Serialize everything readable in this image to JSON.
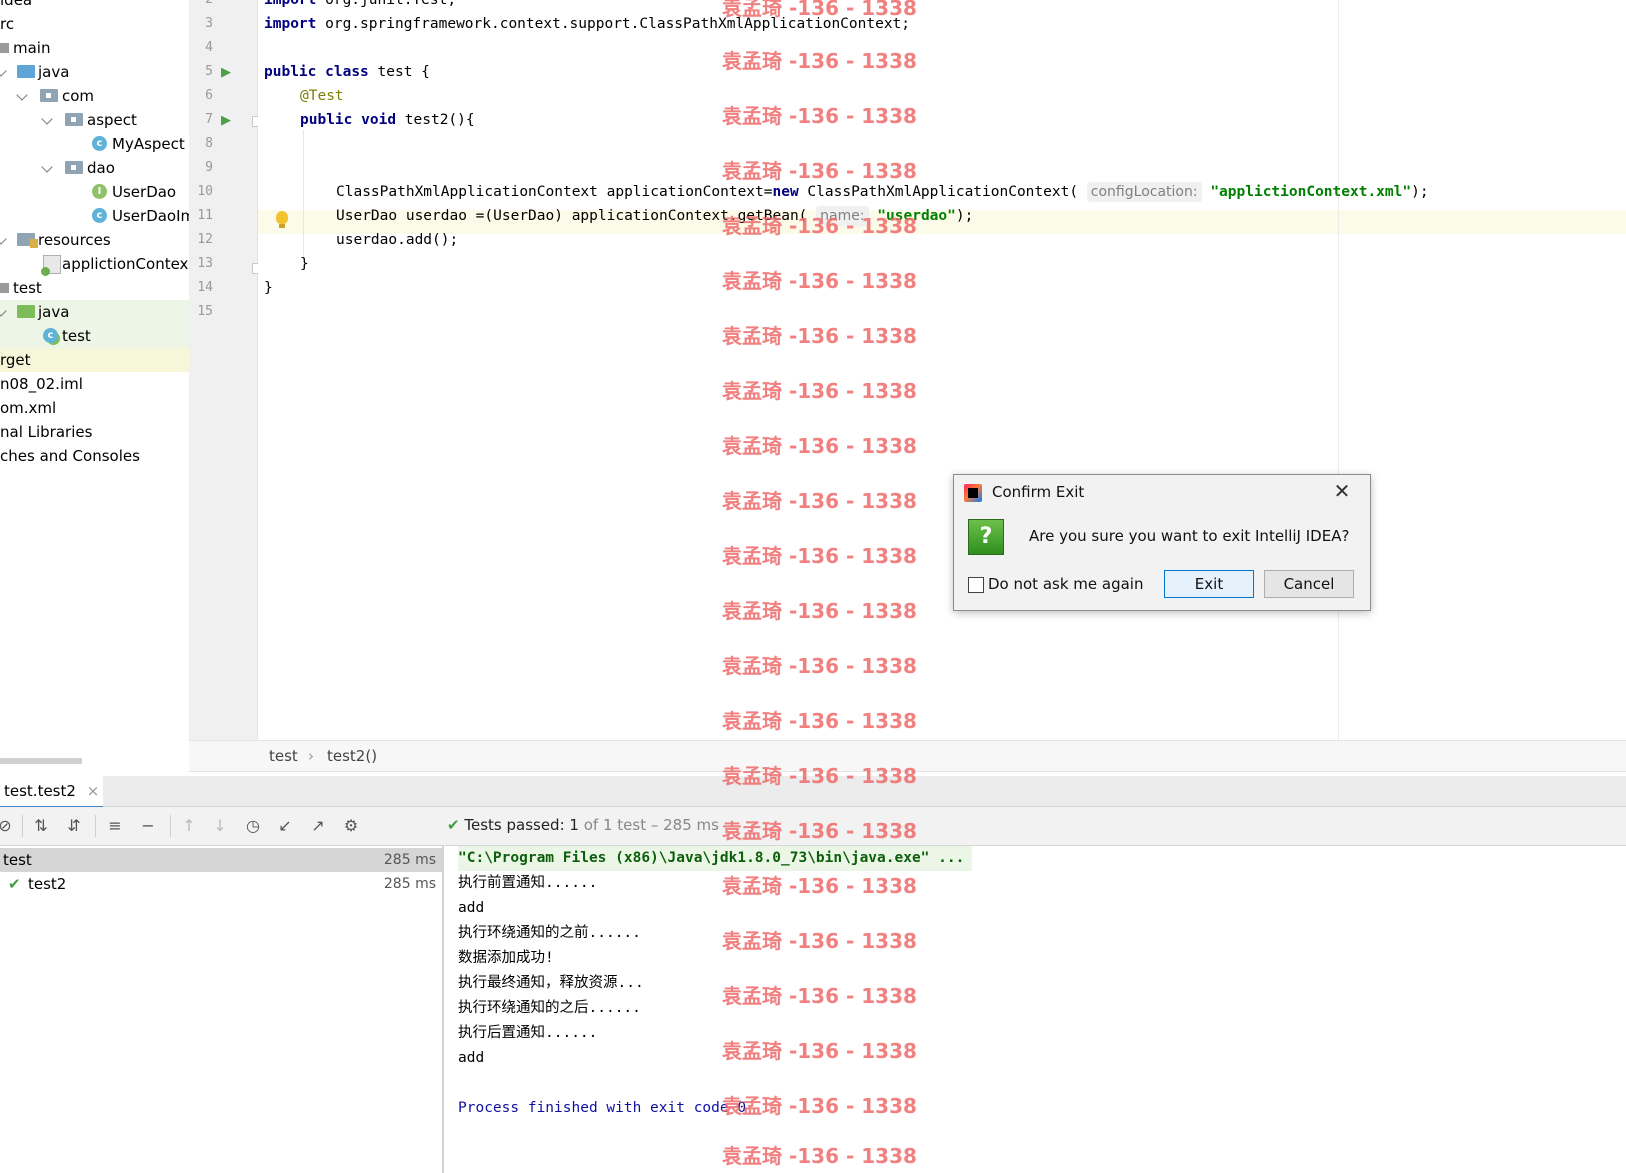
{
  "project_tree": [
    {
      "label": "idea",
      "indent": 0
    },
    {
      "label": "rc",
      "indent": 0
    },
    {
      "label": "main",
      "indent": 0
    },
    {
      "label": "java",
      "indent": 1
    },
    {
      "label": "com",
      "indent": 2
    },
    {
      "label": "aspect",
      "indent": 3
    },
    {
      "label": "MyAspect",
      "indent": 4
    },
    {
      "label": "dao",
      "indent": 3
    },
    {
      "label": "UserDao",
      "indent": 4
    },
    {
      "label": "UserDaoIm",
      "indent": 4
    },
    {
      "label": "resources",
      "indent": 1
    },
    {
      "label": "appliction­Contex",
      "indent": 2
    },
    {
      "label": "test",
      "indent": 0
    },
    {
      "label": "java",
      "indent": 1
    },
    {
      "label": "test",
      "indent": 2
    },
    {
      "label": "rget",
      "indent": 0
    },
    {
      "label": "n08_02.iml",
      "indent": 0
    },
    {
      "label": "om.xml",
      "indent": 0
    },
    {
      "label": "nal Libraries",
      "indent": 0
    },
    {
      "label": "ches and Consoles",
      "indent": 0
    }
  ],
  "editor": {
    "line_numbers": [
      "2",
      "3",
      "4",
      "5",
      "6",
      "7",
      "8",
      "9",
      "10",
      "11",
      "12",
      "13",
      "14",
      "15"
    ],
    "lines": {
      "l2_kw": "import",
      "l2_rest": " org.junit.Test;",
      "l3_kw": "import",
      "l3_rest": " org.springframework.context.support.ClassPathXmlApplicationContext;",
      "l5_kw1": "public",
      "l5_kw2": "class",
      "l5_rest": " test {",
      "l6_ann": "@Test",
      "l7_kw1": "public",
      "l7_kw2": "void",
      "l7_rest": " test2(){",
      "l10_a": "ClassPathXmlApplicationContext applicationContext=",
      "l10_kw": "new",
      "l10_b": " ClassPathXmlApplicationContext(",
      "l10_hint": "configLocation:",
      "l10_str": "\"appliction­Context.xml\"",
      "l10_end": ");",
      "l11_a": "UserDao userdao =(UserDao) applicationContext.getBean(",
      "l11_hint": "name:",
      "l11_str": "\"userdao\"",
      "l11_end": ");",
      "l12": "userdao.add();",
      "l13": "}",
      "l14": "}"
    }
  },
  "breadcrumbs": [
    "test",
    "test2()"
  ],
  "run_panel": {
    "tab_label": "test.test2",
    "status_prefix": "Tests passed:",
    "status_count": "1",
    "status_suffix": "of 1 test – 285 ms",
    "tests": [
      {
        "name": "test",
        "time": "285 ms"
      },
      {
        "name": "test2",
        "time": "285 ms"
      }
    ],
    "console": [
      "\"C:\\Program Files (x86)\\Java\\jdk1.8.0_73\\bin\\java.exe\" ...",
      "执行前置通知......",
      "add",
      "执行环绕通知的之前......",
      "数据添加成功!",
      "执行最终通知，释放资源...",
      "执行环绕通知的之后......",
      "执行后置通知......",
      "add",
      "",
      "Process finished with exit code 0"
    ]
  },
  "dialog": {
    "title": "Confirm Exit",
    "message": "Are you sure you want to exit IntelliJ IDEA?",
    "checkbox_label": "Do not ask me again",
    "exit_label": "Exit",
    "cancel_label": "Cancel"
  },
  "watermark": "袁孟琦 -136 - 1338",
  "colors": {
    "keyword": "#000080",
    "string": "#008000",
    "annotation": "#808000",
    "watermark": "#ef6b6b"
  }
}
